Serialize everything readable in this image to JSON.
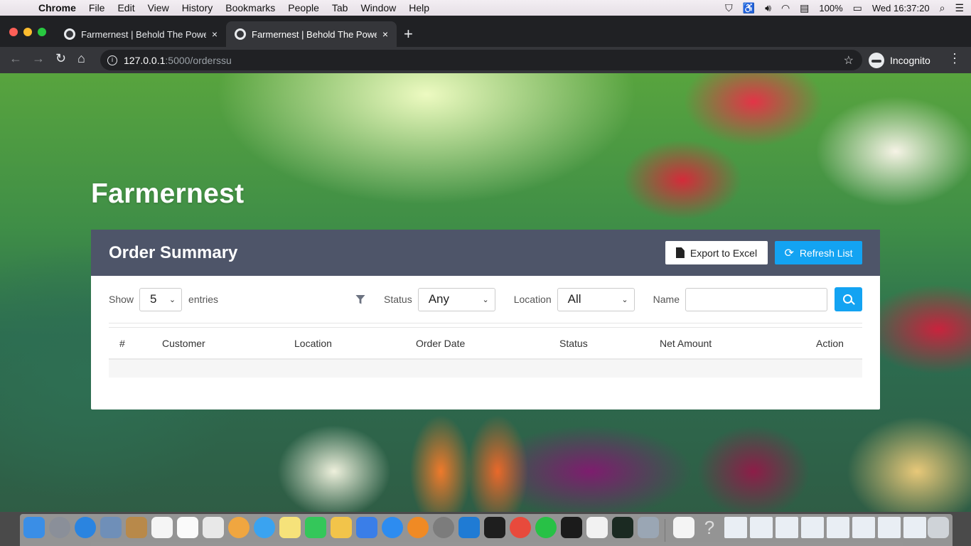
{
  "menubar": {
    "app": "Chrome",
    "items": [
      "File",
      "Edit",
      "View",
      "History",
      "Bookmarks",
      "People",
      "Tab",
      "Window",
      "Help"
    ],
    "battery": "100%",
    "clock": "Wed 16:37:20"
  },
  "browser": {
    "tabs": [
      {
        "title": "Farmernest | Behold The Powe",
        "close": "×"
      },
      {
        "title": "Farmernest | Behold The Powe",
        "close": "×"
      }
    ],
    "new_tab": "+",
    "url_host": "127.0.0.1",
    "url_path": ":5000/orderssu",
    "profile": "Incognito"
  },
  "page": {
    "brand": "Farmernest",
    "card_title": "Order Summary",
    "export_label": "Export to Excel",
    "refresh_label": "Refresh List",
    "show_label": "Show",
    "entries_value": "5",
    "entries_label": "entries",
    "status_label": "Status",
    "status_value": "Any",
    "location_label": "Location",
    "location_value": "All",
    "name_label": "Name",
    "name_value": "",
    "columns": [
      "#",
      "Customer",
      "Location",
      "Order Date",
      "Status",
      "Net Amount",
      "Action"
    ]
  },
  "colors": {
    "card_header": "#4e5569",
    "accent": "#13a3f2"
  }
}
